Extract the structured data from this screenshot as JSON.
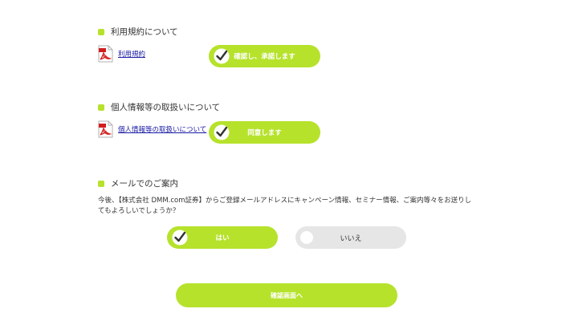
{
  "terms": {
    "section_title": "利用規約について",
    "doc_link": "利用規約",
    "confirm_button": "確認し、承諾します"
  },
  "privacy": {
    "section_title": "個人情報等の取扱いについて",
    "doc_link": "個人情報等の取扱いについて",
    "agree_button": "同意します"
  },
  "mail": {
    "section_title": "メールでのご案内",
    "description": "今後、【株式会社 DMM.com証券】からご登録メールアドレスにキャンペーン情報、セミナー情報、ご案内等々をお送りしてもよろしいでしょうか？",
    "yes_label": "はい",
    "no_label": "いいえ",
    "selected": "yes"
  },
  "submit_button": "確認画面へ",
  "colors": {
    "accent": "#b6e22c",
    "inactive": "#e6e6e6",
    "link": "#1a1aa6",
    "text": "#333333"
  },
  "icons": {
    "document": "pdf-icon",
    "checked": "check-icon",
    "unchecked": "radio-off-icon"
  }
}
